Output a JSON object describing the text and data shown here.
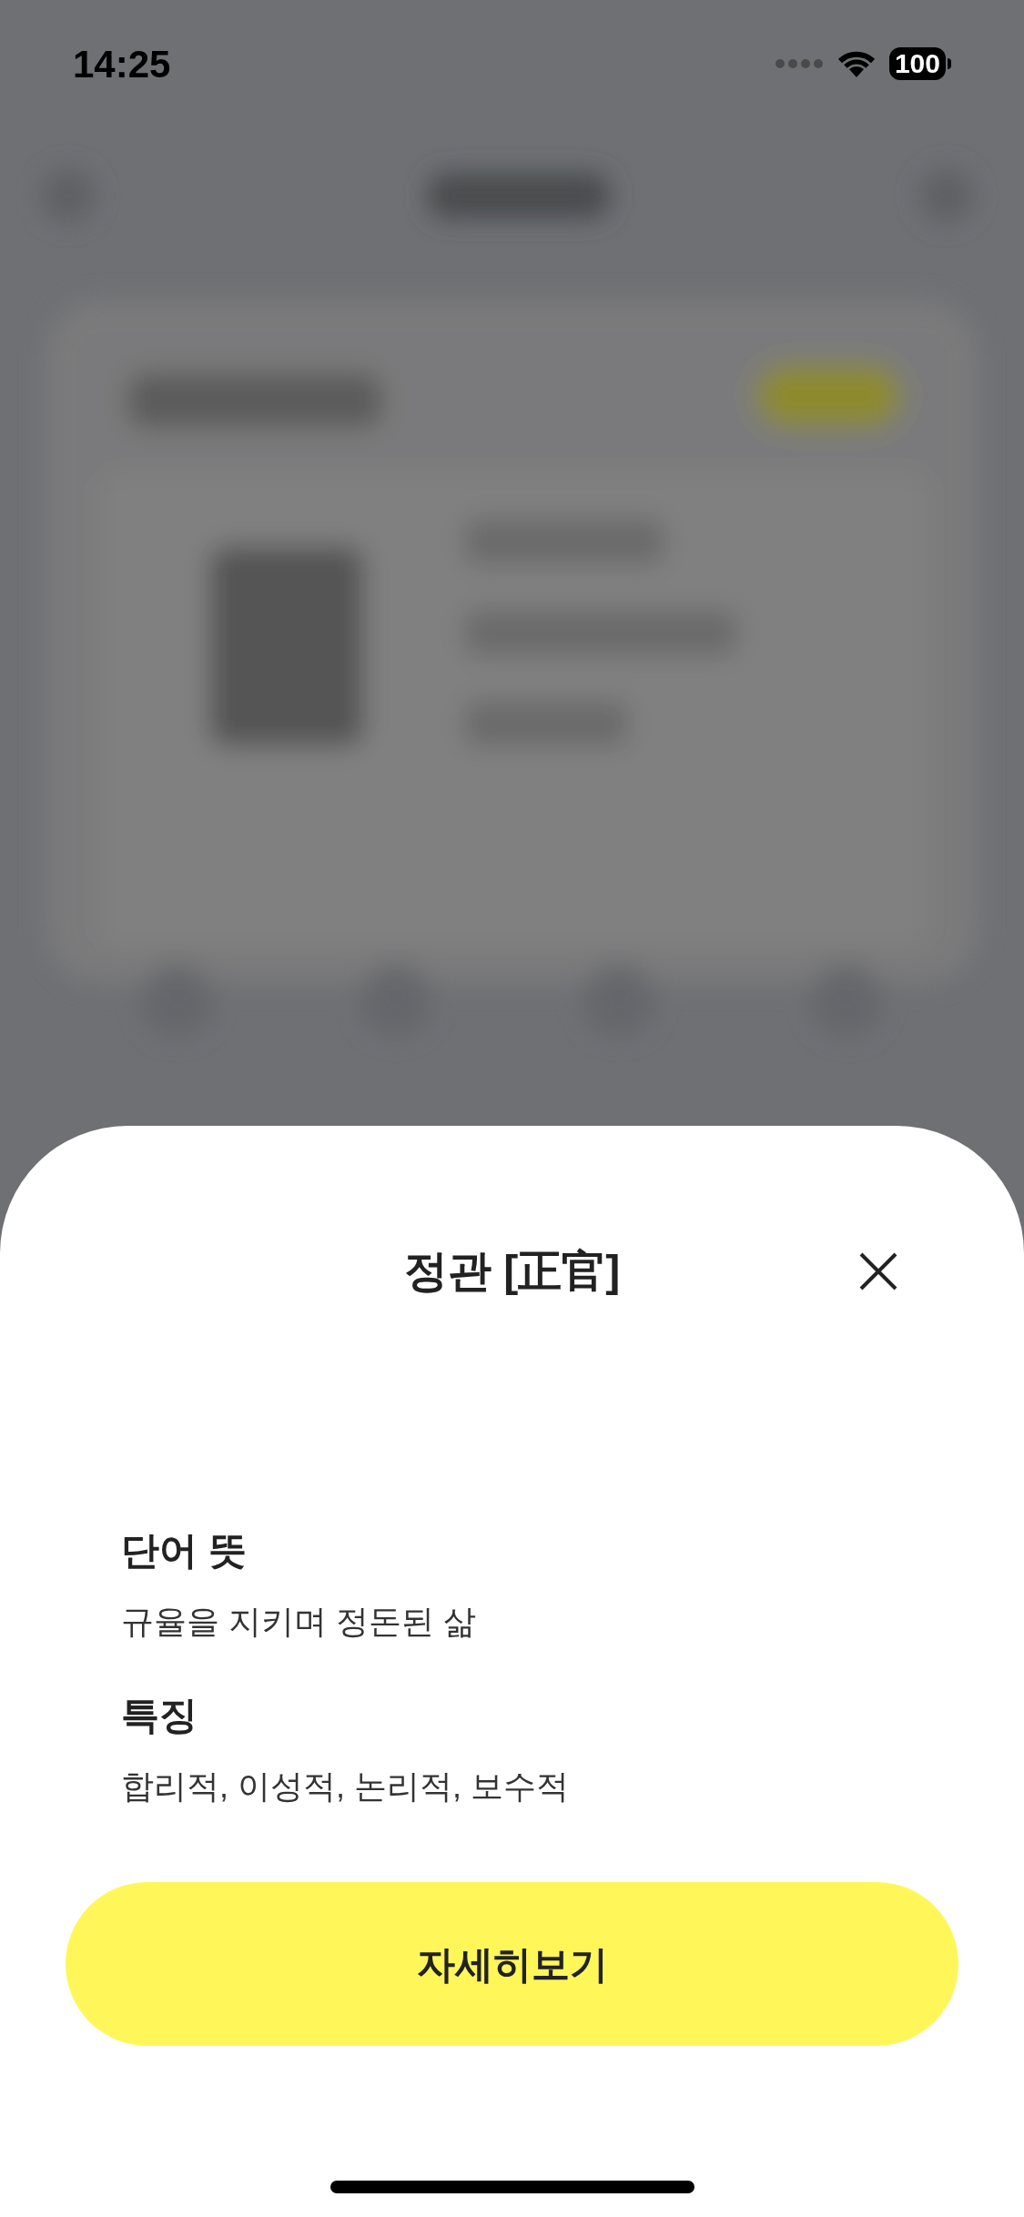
{
  "status_bar": {
    "time": "14:25",
    "battery": "100"
  },
  "sheet": {
    "title": "정관 [正官]",
    "sections": [
      {
        "heading": "단어 뜻",
        "text": "규율을 지키며 정돈된 삶"
      },
      {
        "heading": "특징",
        "text": "합리적, 이성적, 논리적, 보수적"
      }
    ],
    "button": "자세히보기"
  }
}
